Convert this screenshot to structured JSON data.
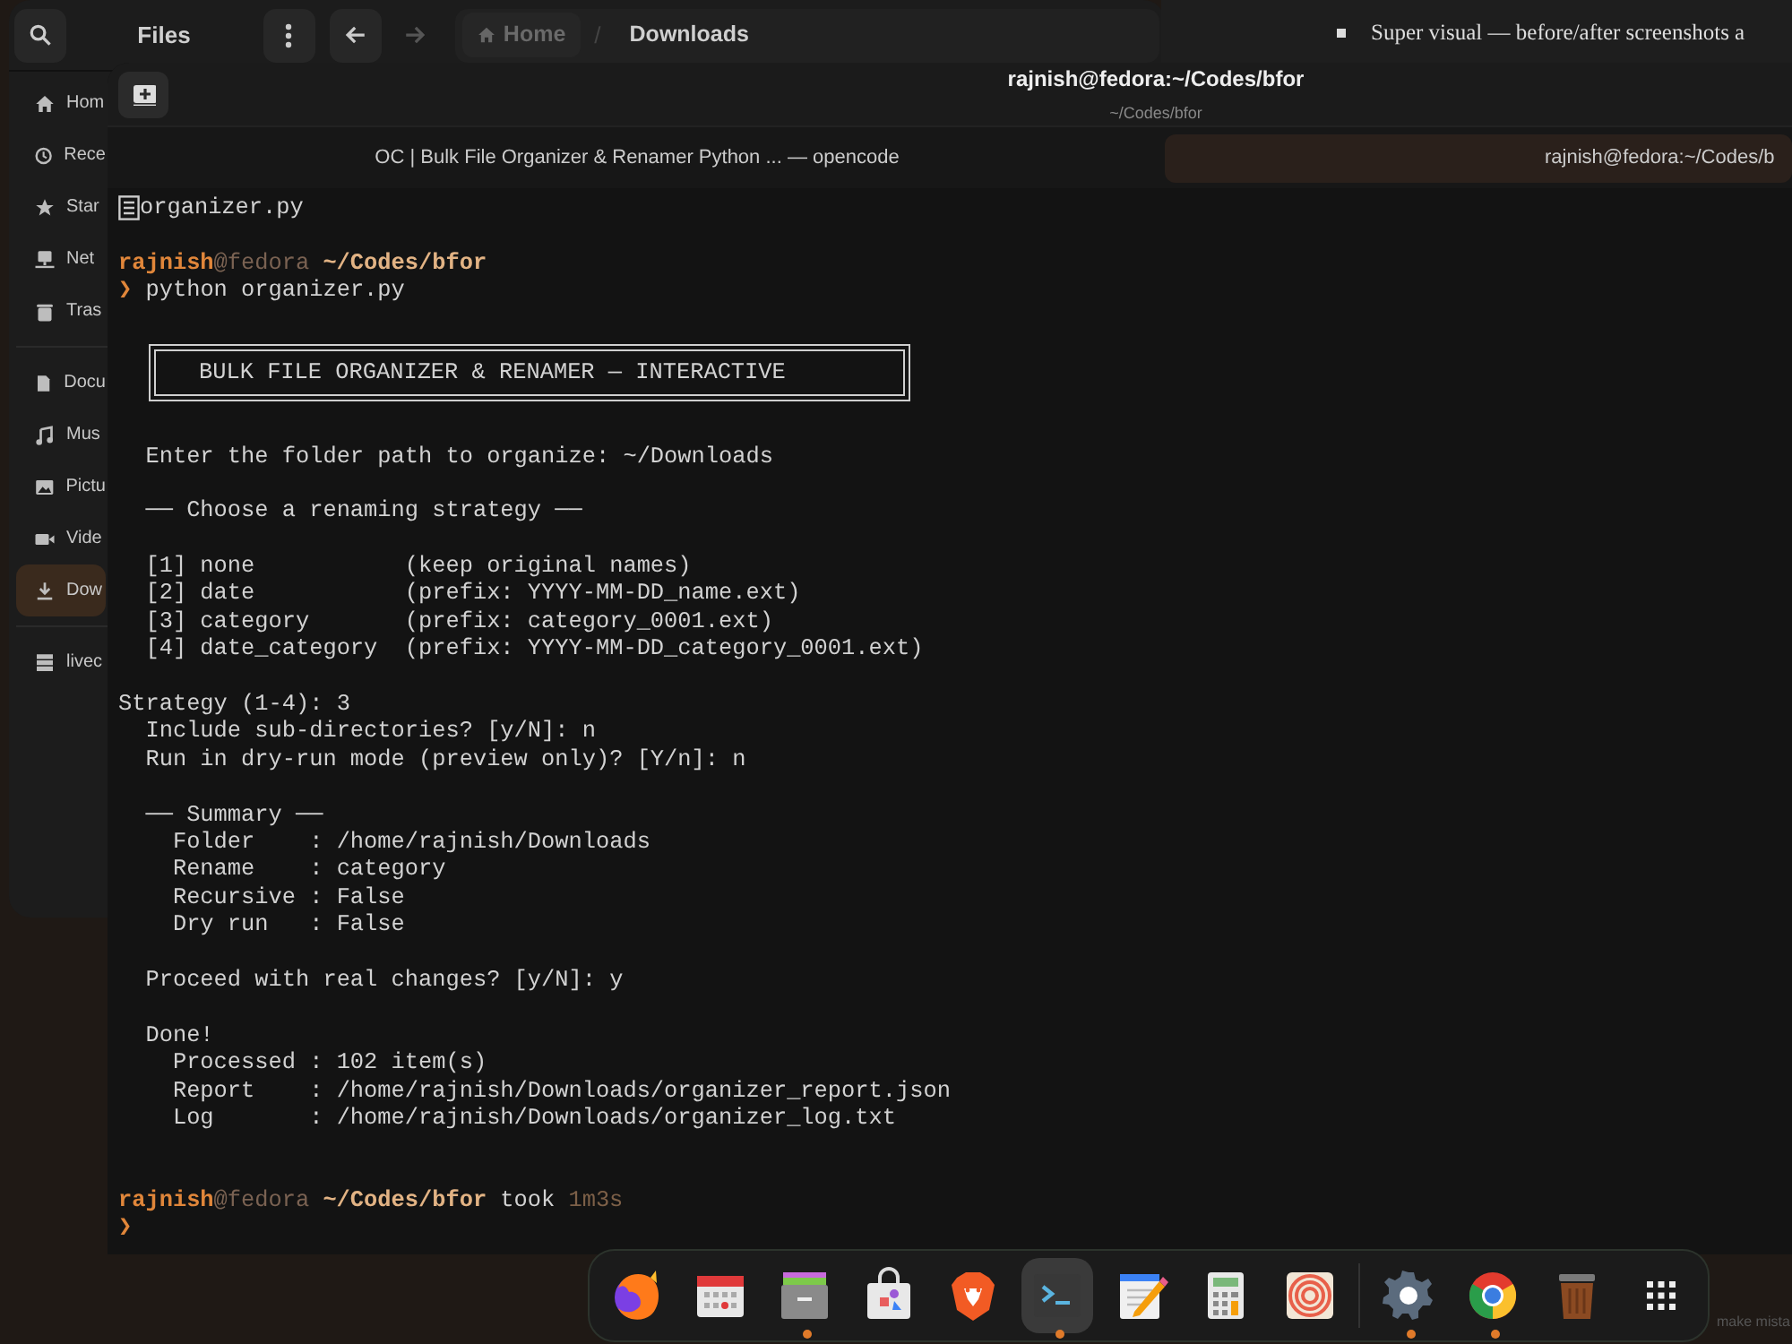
{
  "document_window": {
    "bullet_text": "Super visual — before/after screenshots a"
  },
  "files_window": {
    "title": "Files",
    "back": {
      "disabled": false
    },
    "forward": {
      "disabled": true
    },
    "path": [
      {
        "label": "Home",
        "selected": false
      },
      {
        "label": "Downloads",
        "selected": true
      }
    ],
    "path_separator": "/",
    "sidebar": {
      "sections": [
        {
          "items": [
            {
              "kind": "home",
              "label": "Hom",
              "selected": false
            },
            {
              "kind": "recent",
              "label": "Rece",
              "selected": false
            },
            {
              "kind": "starred",
              "label": "Star",
              "selected": false
            },
            {
              "kind": "network",
              "label": "Net",
              "selected": false
            },
            {
              "kind": "trash",
              "label": "Tras",
              "selected": false
            }
          ]
        },
        {
          "items": [
            {
              "kind": "documents",
              "label": "Docu",
              "selected": false
            },
            {
              "kind": "music",
              "label": "Mus",
              "selected": false
            },
            {
              "kind": "pictures",
              "label": "Pictu",
              "selected": false
            },
            {
              "kind": "videos",
              "label": "Vide",
              "selected": false
            },
            {
              "kind": "downloads",
              "label": "Dow",
              "selected": true
            }
          ]
        },
        {
          "items": [
            {
              "kind": "drive",
              "label": "livec",
              "selected": false
            }
          ]
        }
      ]
    }
  },
  "terminal_window": {
    "title": "rajnish@fedora:~/Codes/bfor",
    "subtitle": "~/Codes/bfor",
    "tabs": [
      {
        "label": "OC | Bulk File Organizer & Renamer Python ... — opencode",
        "selected": false
      },
      {
        "label": "rajnish@fedora:~/Codes/b",
        "selected": true
      }
    ],
    "lines": [
      {
        "kind": "file",
        "text": "organizer.py"
      },
      {
        "kind": "blank"
      },
      {
        "kind": "prompt",
        "user": "rajnish",
        "host": "@fedora",
        "path": "~/Codes/bfor"
      },
      {
        "kind": "command",
        "symbol": "❯",
        "text": "python organizer.py"
      },
      {
        "kind": "blank"
      },
      {
        "kind": "banner",
        "text": "BULK FILE ORGANIZER & RENAMER — INTERACTIVE"
      },
      {
        "kind": "blank"
      },
      {
        "kind": "output",
        "text": "  Enter the folder path to organize: ~/Downloads"
      },
      {
        "kind": "blank"
      },
      {
        "kind": "output",
        "text": "  ── Choose a renaming strategy ──"
      },
      {
        "kind": "blank"
      },
      {
        "kind": "output",
        "text": "  [1] none           (keep original names)"
      },
      {
        "kind": "output",
        "text": "  [2] date           (prefix: YYYY-MM-DD_name.ext)"
      },
      {
        "kind": "output",
        "text": "  [3] category       (prefix: category_0001.ext)"
      },
      {
        "kind": "output",
        "text": "  [4] date_category  (prefix: YYYY-MM-DD_category_0001.ext)"
      },
      {
        "kind": "blank"
      },
      {
        "kind": "output",
        "text": "Strategy (1-4): 3"
      },
      {
        "kind": "output",
        "text": "  Include sub-directories? [y/N]: n"
      },
      {
        "kind": "output",
        "text": "  Run in dry-run mode (preview only)? [Y/n]: n"
      },
      {
        "kind": "blank"
      },
      {
        "kind": "output",
        "text": "  ── Summary ──"
      },
      {
        "kind": "output",
        "text": "    Folder    : /home/rajnish/Downloads"
      },
      {
        "kind": "output",
        "text": "    Rename    : category"
      },
      {
        "kind": "output",
        "text": "    Recursive : False"
      },
      {
        "kind": "output",
        "text": "    Dry run   : False"
      },
      {
        "kind": "blank"
      },
      {
        "kind": "output",
        "text": "  Proceed with real changes? [y/N]: y"
      },
      {
        "kind": "blank"
      },
      {
        "kind": "output",
        "text": "  Done!"
      },
      {
        "kind": "output",
        "text": "    Processed : 102 item(s)"
      },
      {
        "kind": "output",
        "text": "    Report    : /home/rajnish/Downloads/organizer_report.json"
      },
      {
        "kind": "output",
        "text": "    Log       : /home/rajnish/Downloads/organizer_log.txt"
      },
      {
        "kind": "blank"
      },
      {
        "kind": "blank"
      },
      {
        "kind": "prompt",
        "user": "rajnish",
        "host": "@fedora",
        "path": "~/Codes/bfor",
        "took": "took",
        "duration": "1m3s"
      },
      {
        "kind": "command",
        "symbol": "❯"
      }
    ]
  },
  "dock": {
    "items": [
      {
        "kind": "firefox",
        "running": false,
        "selected": false
      },
      {
        "kind": "calendar",
        "running": false,
        "selected": false
      },
      {
        "kind": "files",
        "running": true,
        "selected": false
      },
      {
        "kind": "store",
        "running": false,
        "selected": false
      },
      {
        "kind": "lion",
        "running": false,
        "selected": false
      },
      {
        "kind": "terminal",
        "running": true,
        "selected": true
      },
      {
        "kind": "editor",
        "running": false,
        "selected": false
      },
      {
        "kind": "calculator",
        "running": false,
        "selected": false
      },
      {
        "kind": "target",
        "running": false,
        "selected": false
      },
      {
        "kind": "separator"
      },
      {
        "kind": "settings",
        "running": true,
        "selected": false
      },
      {
        "kind": "chrome",
        "running": true,
        "selected": false
      },
      {
        "kind": "trash",
        "running": false,
        "selected": false
      },
      {
        "kind": "apps",
        "running": false,
        "selected": false
      }
    ]
  },
  "background_text": "make mista"
}
